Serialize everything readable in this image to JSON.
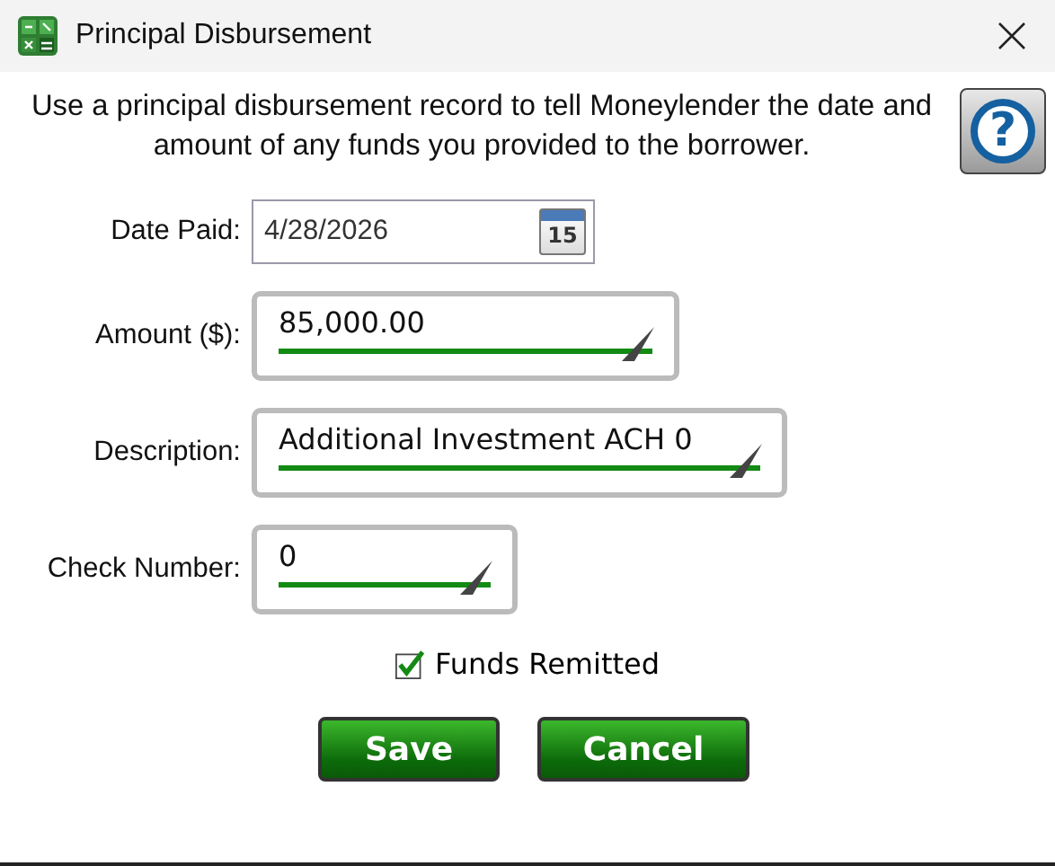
{
  "window": {
    "title": "Principal Disbursement"
  },
  "intro": "Use a principal disbursement record to tell Moneylender the date and amount of any funds you provided to the borrower.",
  "help_button": {
    "label": "?"
  },
  "fields": [
    {
      "kind": "date",
      "label": "Date Paid:",
      "value": "4/28/2026",
      "calendar_day": "15"
    },
    {
      "kind": "text",
      "label": "Amount ($):",
      "value": "85,000.00"
    },
    {
      "kind": "text",
      "label": "Description:",
      "value": "Additional Investment ACH 0"
    },
    {
      "kind": "text",
      "label": "Check Number:",
      "value": "0"
    }
  ],
  "funds_remitted": {
    "label": "Funds Remitted",
    "checked": true
  },
  "buttons": [
    "Save",
    "Cancel"
  ]
}
